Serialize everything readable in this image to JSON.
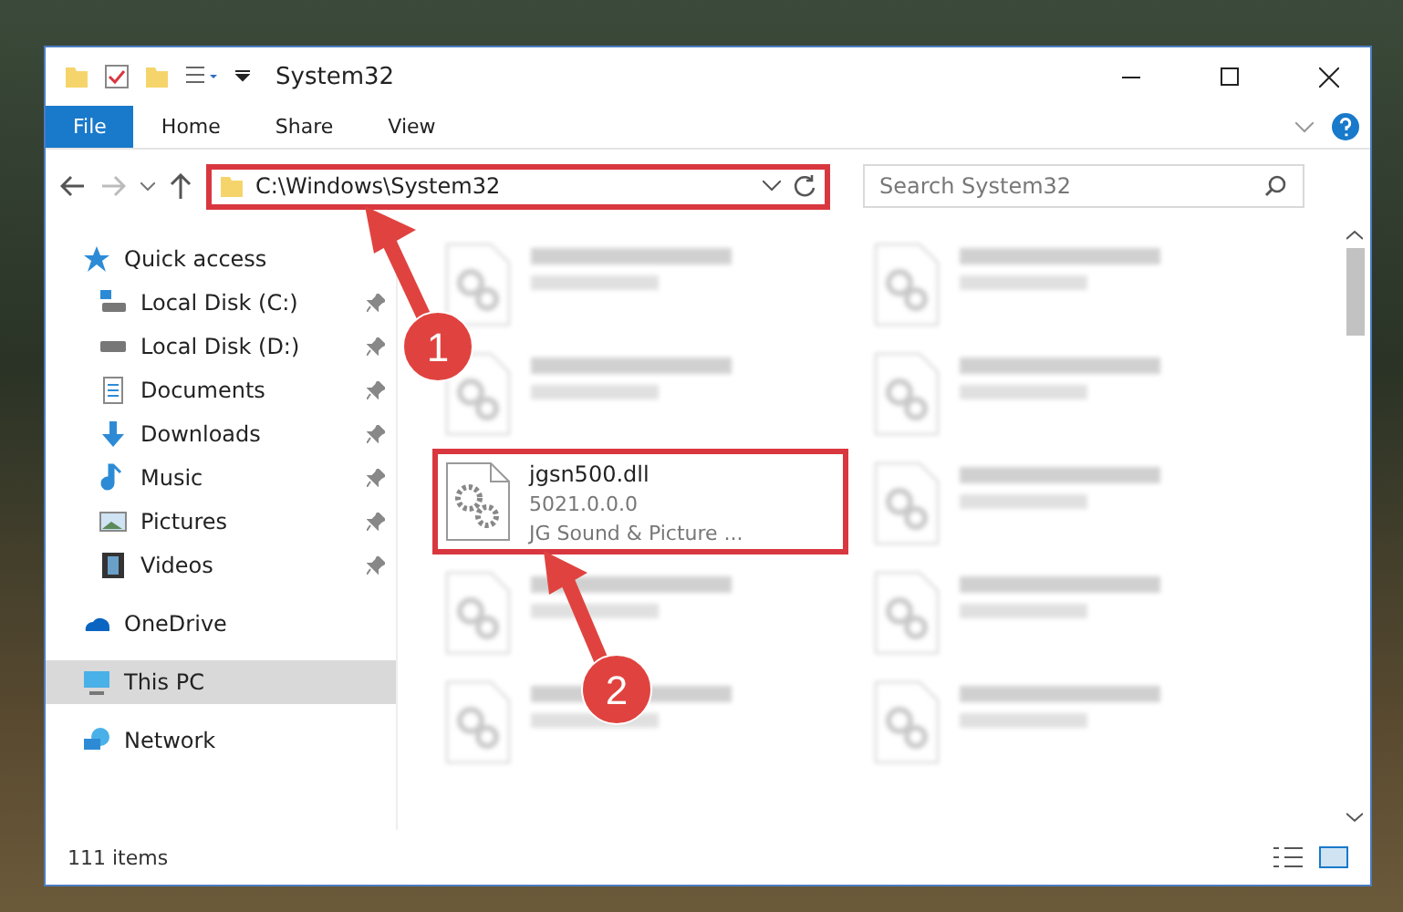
{
  "window": {
    "title": "System32"
  },
  "ribbon_tabs": [
    {
      "label": "File",
      "kind": "file",
      "selected": false
    },
    {
      "label": "Home",
      "kind": "tab",
      "selected": false
    },
    {
      "label": "Share",
      "kind": "tab",
      "selected": false
    },
    {
      "label": "View",
      "kind": "tab",
      "selected": false
    }
  ],
  "address_bar": {
    "path": "C:\\Windows\\System32",
    "highlighted": true
  },
  "search": {
    "placeholder": "Search System32"
  },
  "sidebar": {
    "items": [
      {
        "label": "Quick access",
        "kind": "star",
        "pinned": false,
        "selected": false,
        "children": [
          {
            "label": "Local Disk (C:)",
            "kind": "windrive",
            "pinned": true,
            "selected": false
          },
          {
            "label": "Local Disk (D:)",
            "kind": "drive",
            "pinned": true,
            "selected": false
          },
          {
            "label": "Documents",
            "kind": "document",
            "pinned": true,
            "selected": false
          },
          {
            "label": "Downloads",
            "kind": "download",
            "pinned": true,
            "selected": false
          },
          {
            "label": "Music",
            "kind": "music",
            "pinned": true,
            "selected": false
          },
          {
            "label": "Pictures",
            "kind": "picture",
            "pinned": true,
            "selected": false
          },
          {
            "label": "Videos",
            "kind": "video",
            "pinned": true,
            "selected": false
          }
        ]
      },
      {
        "label": "OneDrive",
        "kind": "cloud",
        "pinned": false,
        "selected": false
      },
      {
        "label": "This PC",
        "kind": "pc",
        "pinned": false,
        "selected": true
      },
      {
        "label": "Network",
        "kind": "network",
        "pinned": false,
        "selected": false
      }
    ]
  },
  "files": [
    {
      "kind": "blurred"
    },
    {
      "kind": "blurred"
    },
    {
      "kind": "blurred"
    },
    {
      "kind": "blurred"
    },
    {
      "kind": "file",
      "name": "jgsn500.dll",
      "lines": [
        "5021.0.0.0",
        "JG Sound & Picture ..."
      ],
      "highlighted": true
    },
    {
      "kind": "blurred"
    },
    {
      "kind": "blurred"
    },
    {
      "kind": "blurred"
    },
    {
      "kind": "blurred"
    },
    {
      "kind": "blurred"
    }
  ],
  "status_bar": {
    "count": "111 items"
  },
  "callouts": [
    "1",
    "2"
  ]
}
